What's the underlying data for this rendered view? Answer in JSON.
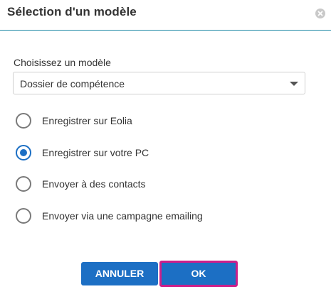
{
  "dialog": {
    "title": "Sélection d'un modèle",
    "close_icon": "close-circle-icon"
  },
  "template_field": {
    "label": "Choisissez un modèle",
    "selected": "Dossier de compétence",
    "caret_icon": "caret-down-icon"
  },
  "options": [
    {
      "label": "Enregistrer sur Eolia",
      "checked": false
    },
    {
      "label": "Enregistrer sur votre PC",
      "checked": true
    },
    {
      "label": "Envoyer à des contacts",
      "checked": false
    },
    {
      "label": "Envoyer via une campagne emailing",
      "checked": false
    }
  ],
  "buttons": {
    "cancel": "ANNULER",
    "ok": "OK"
  },
  "colors": {
    "accent": "#1c6fc4",
    "header_border": "#1c88a5",
    "highlight_border": "#cc1f8a"
  }
}
